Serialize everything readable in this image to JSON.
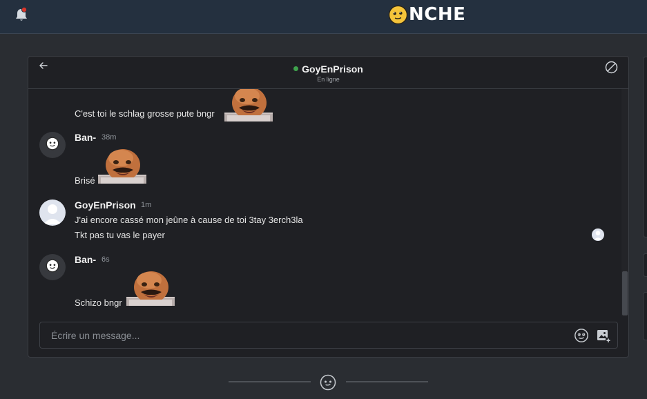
{
  "app": {
    "logo_text": "NCHE",
    "colors": {
      "topbar_bg": "#24303f",
      "page_bg": "#2a2d32",
      "panel_bg": "#1f2024",
      "online": "#3fa34d",
      "logo_face": "#f5c43a",
      "notification_dot": "#d9352a"
    },
    "icons": {
      "notifications": "bell-icon",
      "logo": "onche-face-icon"
    }
  },
  "chat": {
    "contact_name": "GoyEnPrison",
    "contact_status": "En ligne",
    "icons": {
      "back": "arrow-left-icon",
      "block": "block-icon",
      "emoji": "emoji-icon",
      "image": "add-image-icon"
    },
    "messages": [
      {
        "author": null,
        "lines": [
          "C'est toi le schlag grosse pute bngr"
        ],
        "sticker": "sticker-laughing-man"
      },
      {
        "author": "Ban-",
        "time": "38m",
        "lines": [
          "Brisé"
        ],
        "sticker": "sticker-laughing-man"
      },
      {
        "author": "GoyEnPrison",
        "time": "1m",
        "lines": [
          "J'ai encore cassé mon jeûne à cause de toi 3tay 3erch3la",
          "Tkt pas tu vas le payer"
        ]
      },
      {
        "author": "Ban-",
        "time": "6s",
        "lines": [
          "Schizo bngr"
        ],
        "sticker": "sticker-laughing-man"
      }
    ],
    "composer": {
      "placeholder": "Écrire un message...",
      "value": ""
    }
  }
}
